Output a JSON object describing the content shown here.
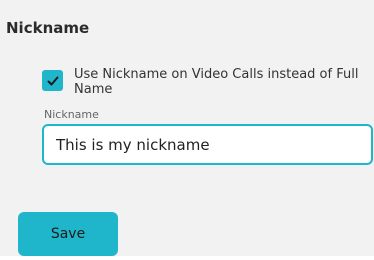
{
  "section": {
    "title": "Nickname"
  },
  "option": {
    "checked": true,
    "label": "Use Nickname on Video Calls instead of Full Name"
  },
  "nickname_field": {
    "label": "Nickname",
    "value": "This is my nickname"
  },
  "actions": {
    "save_label": "Save"
  },
  "colors": {
    "accent": "#1fb6cc",
    "panel_background": "#f2f2f2"
  },
  "icons": {
    "checkbox_mark": "checkmark-icon"
  }
}
